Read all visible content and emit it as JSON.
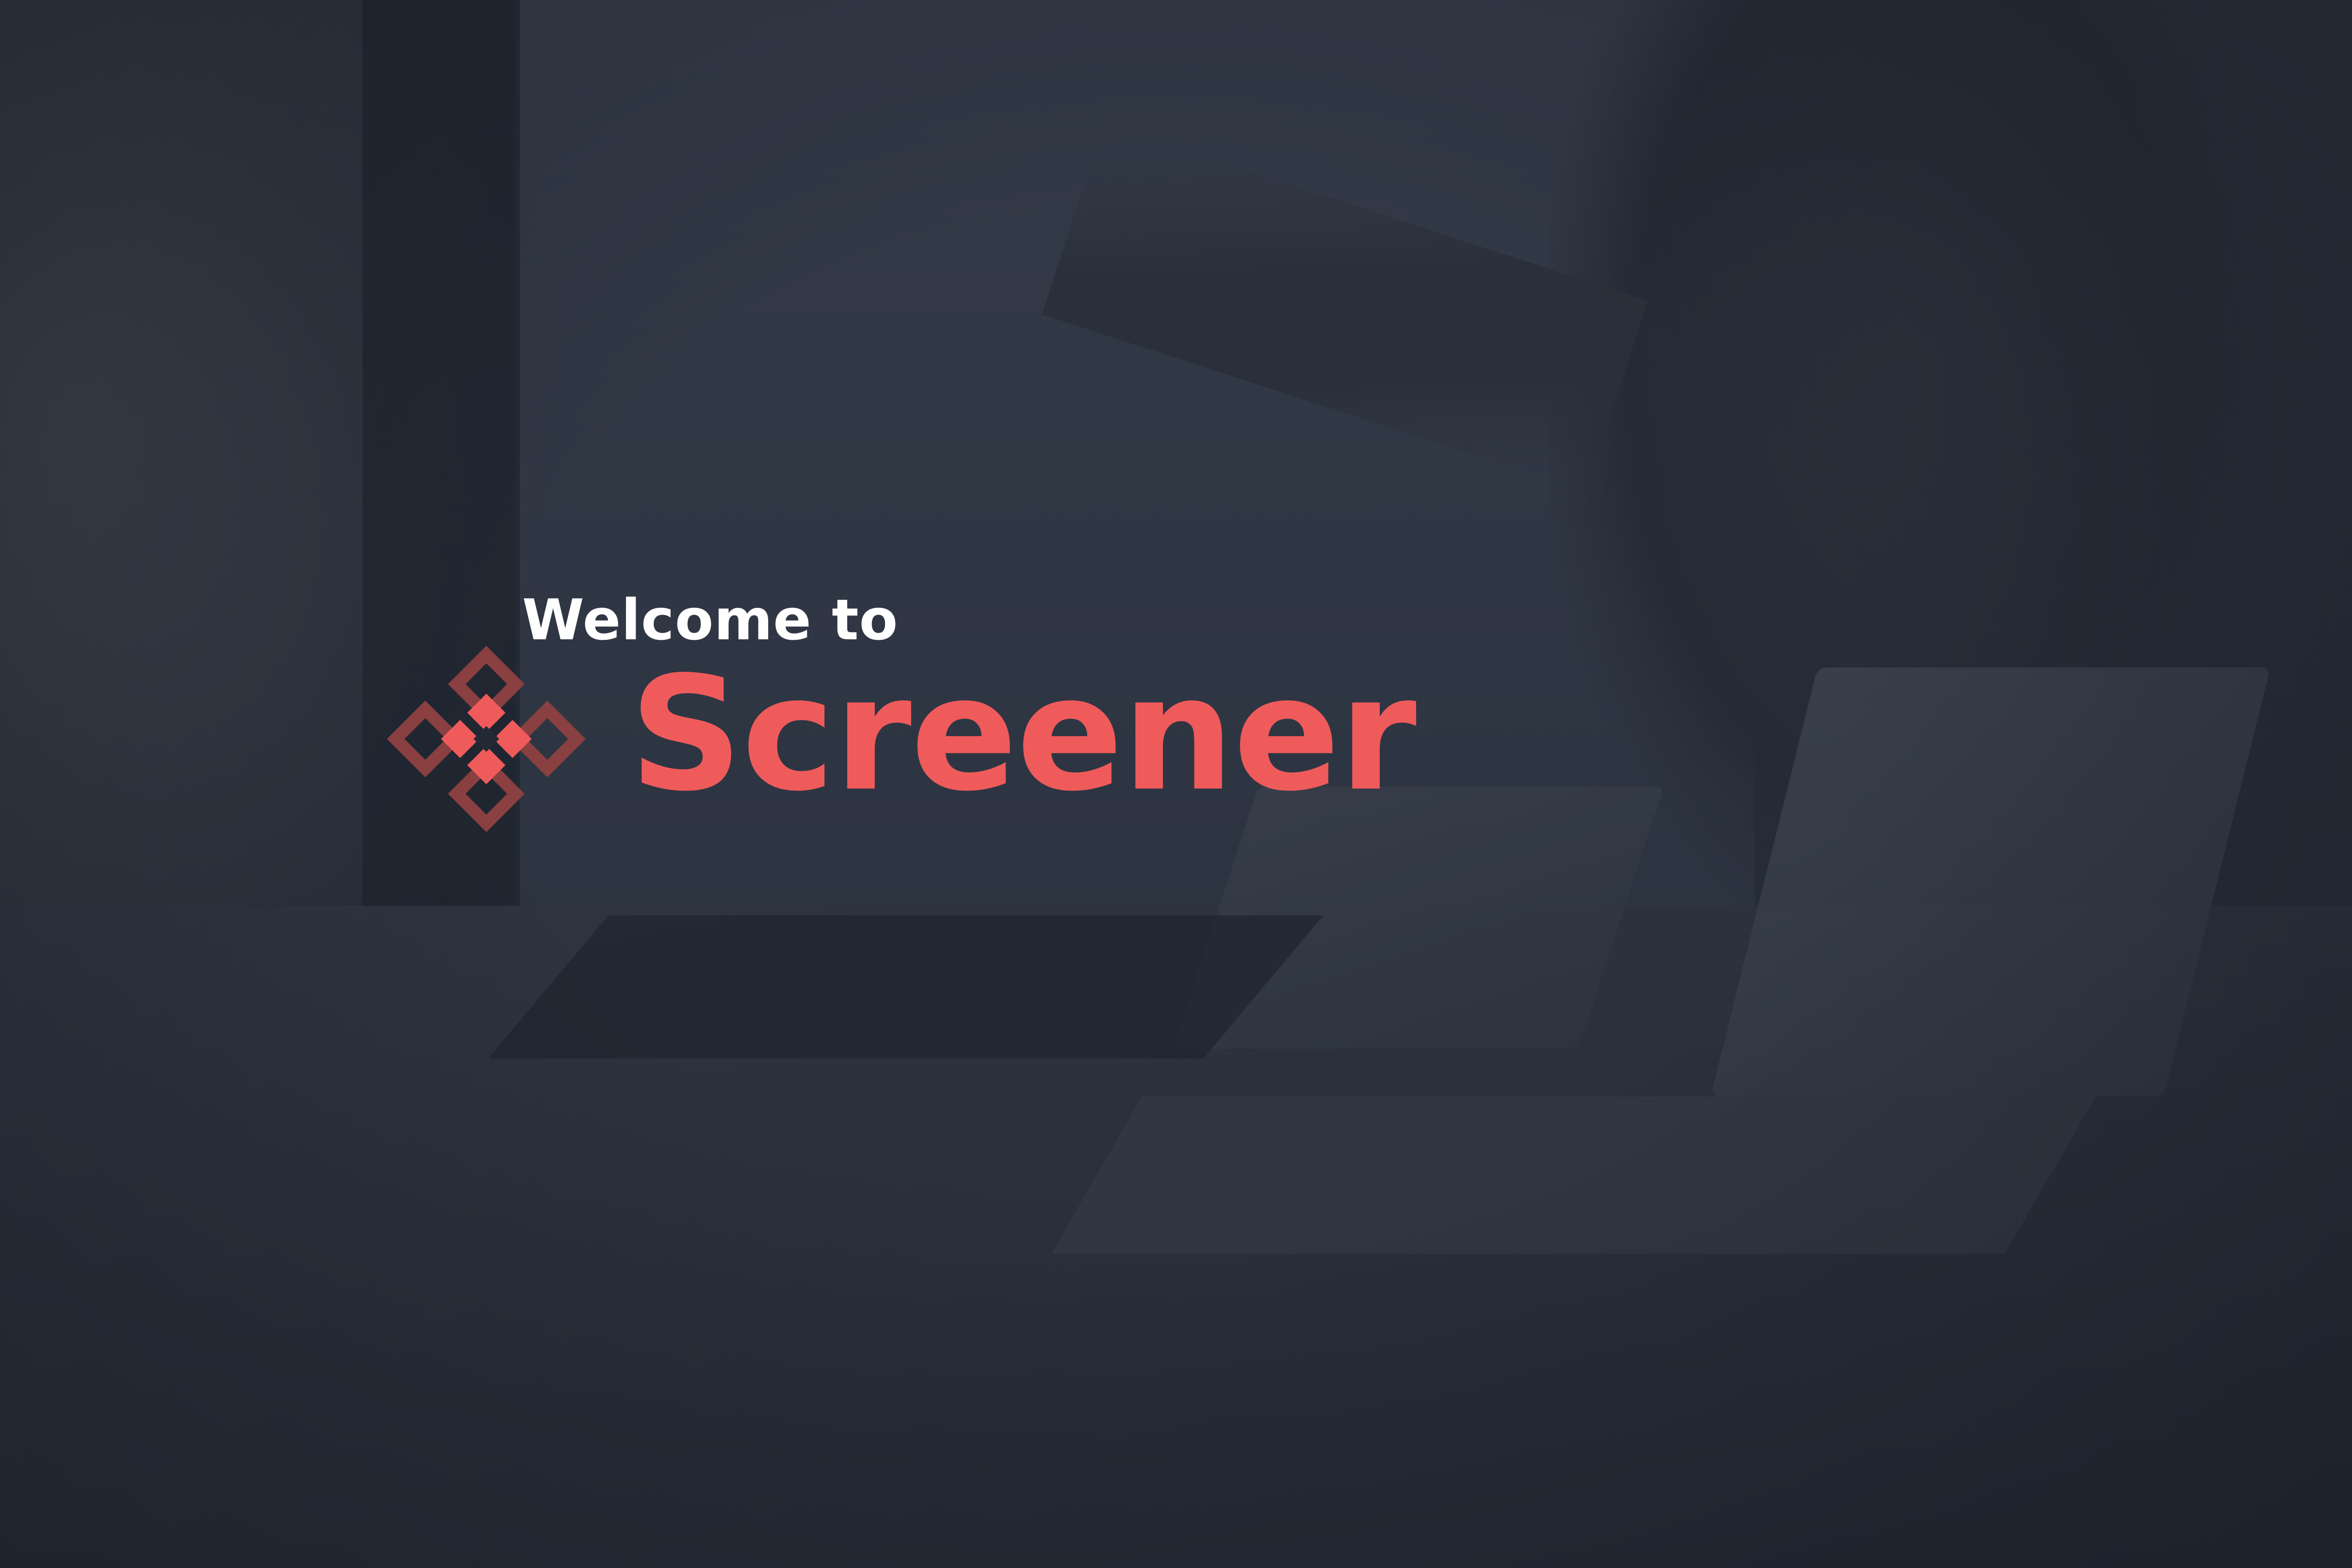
{
  "splash": {
    "welcome_text": "Welcome to",
    "brand_name": "Screener",
    "logo_icon": "screener-diamond-logo-icon",
    "colors": {
      "brand_accent": "#ef5b5b",
      "logo_dark": "#8a3f40",
      "welcome_text": "#ffffff",
      "overlay": "#232a36"
    }
  }
}
